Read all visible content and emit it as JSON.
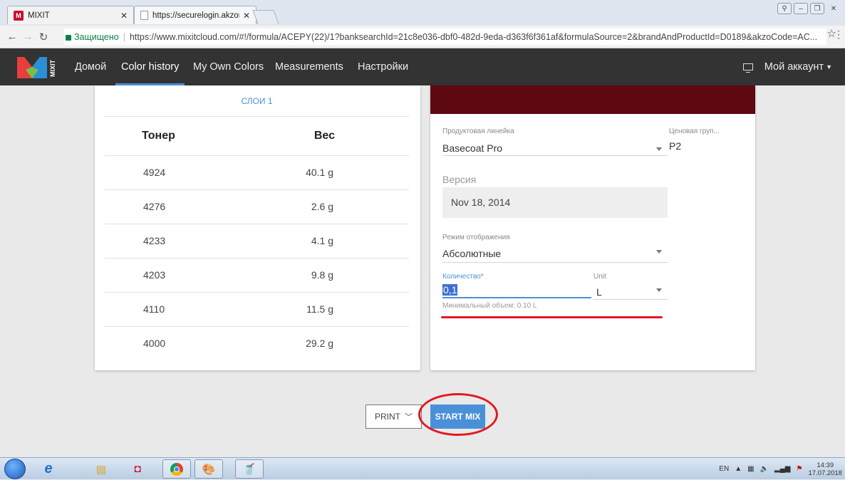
{
  "browser": {
    "tabs": [
      {
        "title": "MIXIT",
        "active": true
      },
      {
        "title": "https://securelogin.akzon",
        "active": false
      }
    ],
    "secure_label": "Защищено",
    "url": "https://www.mixitcloud.com/#!/formula/ACEPY(22)/1?banksearchId=21c8e036-dbf0-482d-9eda-d363f6f361af&formulaSource=2&brandAndProductId=D0189&akzoCode=AC..."
  },
  "app": {
    "logo_text": "MIXIT",
    "nav": [
      {
        "label": "Домой",
        "active": false
      },
      {
        "label": "Color history",
        "active": true
      },
      {
        "label": "My Own Colors",
        "active": false
      },
      {
        "label": "Measurements",
        "active": false
      },
      {
        "label": "Настройки",
        "active": false
      }
    ],
    "account_label": "Мой аккаунт"
  },
  "layers": {
    "title": "СЛОИ 1",
    "col_toner": "Тонер",
    "col_weight": "Вес",
    "rows": [
      {
        "toner": "4924",
        "weight": "40.1 g"
      },
      {
        "toner": "4276",
        "weight": "2.6 g"
      },
      {
        "toner": "4233",
        "weight": "4.1 g"
      },
      {
        "toner": "4203",
        "weight": "9.8 g"
      },
      {
        "toner": "4110",
        "weight": "11.5 g"
      },
      {
        "toner": "4000",
        "weight": "29.2 g"
      }
    ]
  },
  "details": {
    "swatch_color": "#5e0811",
    "product_line_label": "Продуктовая линейка",
    "product_line_value": "Basecoat Pro",
    "price_group_label": "Ценовая груп...",
    "price_group_value": "P2",
    "version_label": "Версия",
    "version_value": "Nov 18, 2014",
    "display_mode_label": "Режим отображения",
    "display_mode_value": "Абсолютные",
    "quantity_label": "Количество*",
    "quantity_value": "0,1",
    "unit_label": "Unit",
    "unit_value": "L",
    "min_volume_hint": "Минимальный объем: 0.10 L"
  },
  "actions": {
    "print_label": "PRINT",
    "start_mix_label": "START MIX"
  },
  "taskbar": {
    "lang": "EN",
    "time": "14:39",
    "date": "17.07.2018"
  },
  "colors": {
    "accent": "#4a90d9",
    "appbar": "#333333",
    "annotation_red": "#e0191f"
  }
}
